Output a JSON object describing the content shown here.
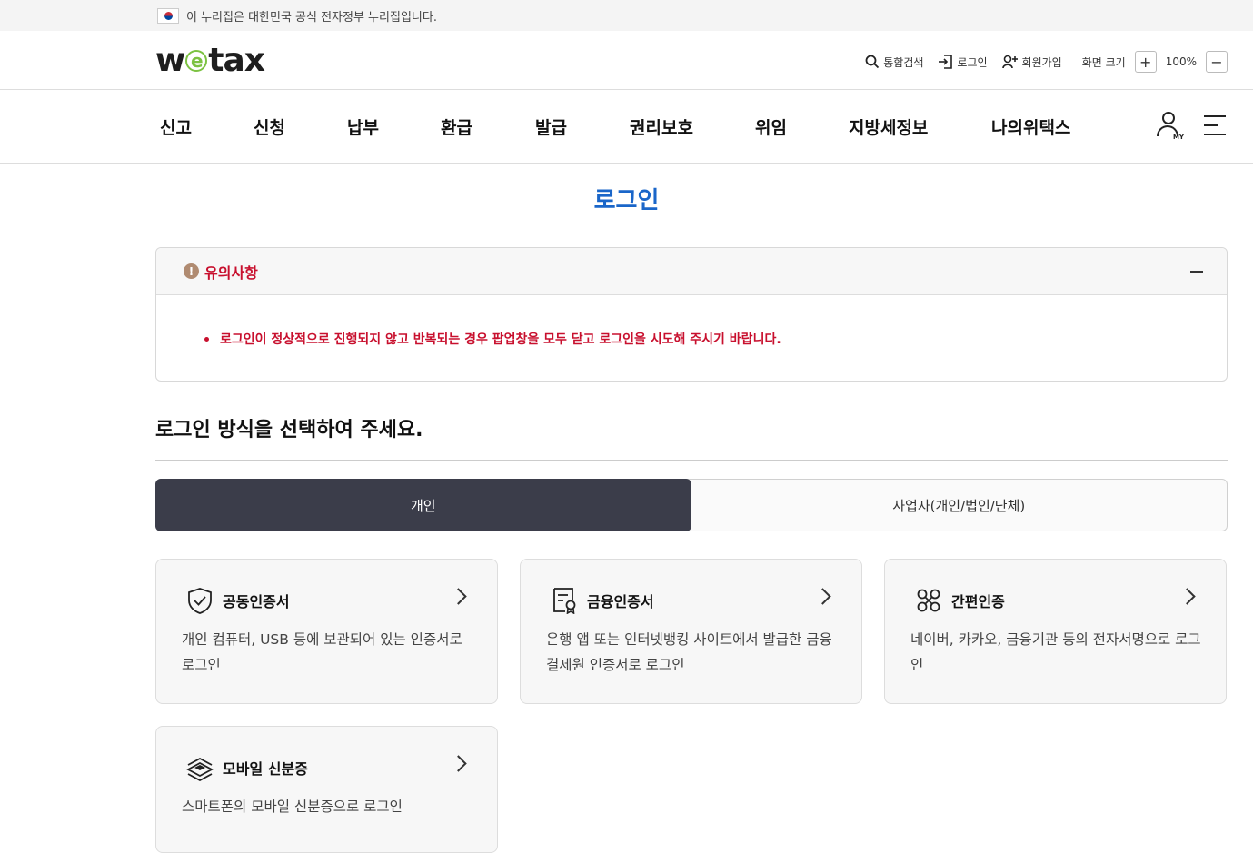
{
  "gov_banner": {
    "text": "이 누리집은 대한민국 공식 전자정부 누리집입니다."
  },
  "header": {
    "logo_left": "w",
    "logo_e": "e",
    "logo_right": "tax",
    "util": {
      "search": "통합검색",
      "login": "로그인",
      "join": "회원가입",
      "screen_size": "화면 크기",
      "zoom_in": "+",
      "zoom_value": "100%",
      "zoom_out": "−"
    }
  },
  "gnb": {
    "items": [
      "신고",
      "신청",
      "납부",
      "환급",
      "발급",
      "권리보호",
      "위임",
      "지방세정보",
      "나의위택스"
    ],
    "my_label": "MY"
  },
  "page": {
    "title": "로그인"
  },
  "notice": {
    "title": "유의사항",
    "message": "로그인이 정상적으로 진행되지 않고 반복되는 경우 팝업창을 모두 닫고 로그인을 시도해 주시기 바랍니다."
  },
  "section": {
    "title": "로그인 방식을 선택하여 주세요."
  },
  "tabs": [
    {
      "label": "개인",
      "active": true
    },
    {
      "label": "사업자(개인/법인/단체)",
      "active": false
    }
  ],
  "cards": [
    {
      "title": "공동인증서",
      "icon": "shield-check-icon",
      "desc": "개인 컴퓨터, USB 등에 보관되어 있는 인증서로 로그인"
    },
    {
      "title": "금융인증서",
      "icon": "certificate-icon",
      "desc": "은행 앱 또는 인터넷뱅킹 사이트에서 발급한 금융결제원 인증서로 로그인"
    },
    {
      "title": "간편인증",
      "icon": "simple-auth-icon",
      "desc": "네이버, 카카오, 금융기관 등의 전자서명으로 로그인"
    },
    {
      "title": "모바일 신분증",
      "icon": "mobile-id-icon",
      "desc": "스마트폰의 모바일 신분증으로 로그인"
    }
  ],
  "colors": {
    "accent": "#1a66c9",
    "warning": "#c8102e",
    "tab_active": "#3b3d4a",
    "logo_e": "#7cc242"
  }
}
